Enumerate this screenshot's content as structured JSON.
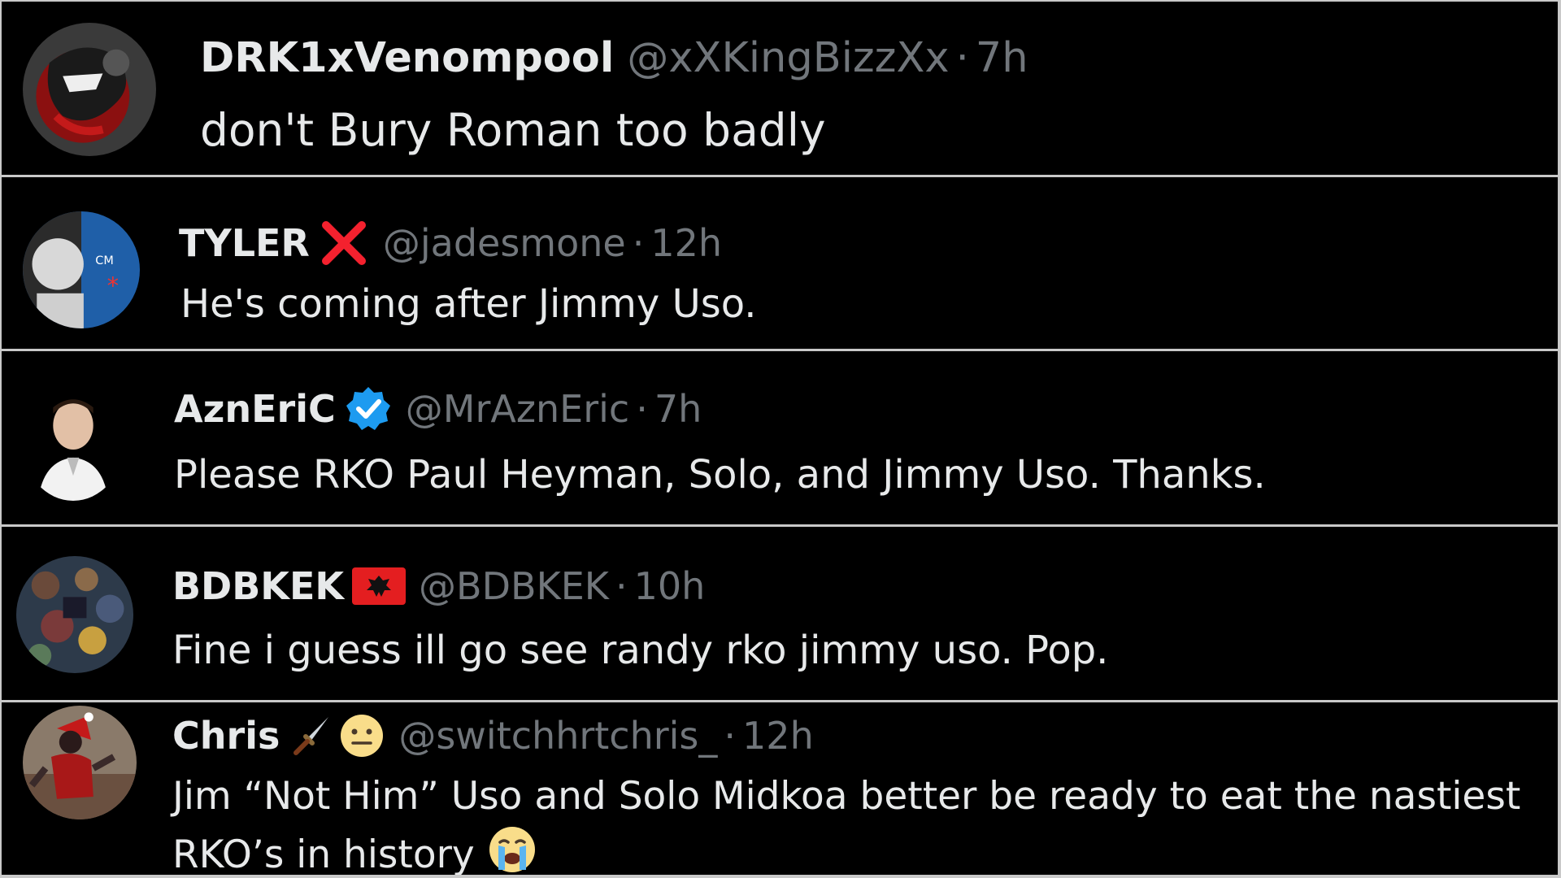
{
  "posts": [
    {
      "display_name": "DRK1xVenompool",
      "badge_icon": "",
      "handle": "@xXKingBizzXx",
      "separator": "·",
      "time": "7h",
      "text": "don't Bury Roman too badly"
    },
    {
      "display_name": "TYLER",
      "badge_icon": "red-x-icon",
      "handle": "@jadesmone",
      "separator": "·",
      "time": "12h",
      "text": "He's coming after Jimmy Uso."
    },
    {
      "display_name": "AznEriC",
      "badge_icon": "verified-badge-icon",
      "handle": "@MrAznEric",
      "separator": "·",
      "time": "7h",
      "text": "Please RKO Paul Heyman, Solo, and Jimmy Uso. Thanks."
    },
    {
      "display_name": "BDBKEK",
      "badge_icon": "albania-flag-icon",
      "handle": "@BDBKEK",
      "separator": "·",
      "time": "10h",
      "text": "Fine i guess ill go see randy rko jimmy uso. Pop."
    },
    {
      "display_name": "Chris",
      "badge_icon": "dagger-icon neutral-face-icon",
      "handle": "@switchhrtchris_",
      "separator": "·",
      "time": "12h",
      "text": "Jim “Not Him” Uso and Solo Midkoa better be ready to eat the nastiest RKO’s in history",
      "trailing_emoji": "crying-face-icon"
    }
  ],
  "colors": {
    "background": "#000000",
    "divider": "#c9c9c9",
    "name": "#e7e9ea",
    "secondary": "#71767b",
    "verified": "#1d9bf0",
    "red_x": "#f4212e"
  }
}
